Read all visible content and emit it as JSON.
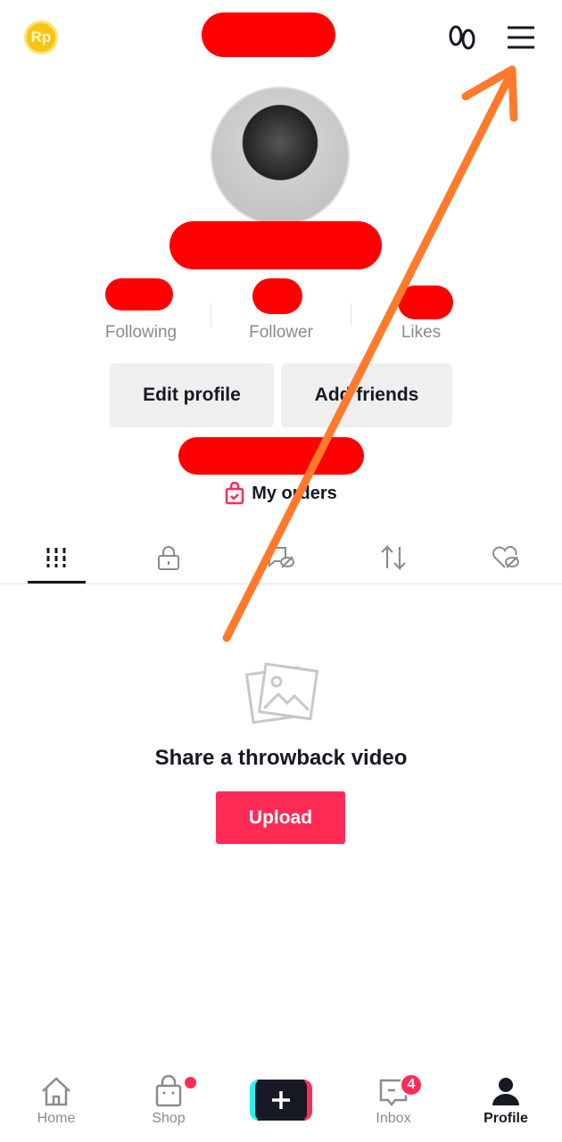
{
  "header": {
    "coin_label": "Rp",
    "footprints_icon": "footprints-icon",
    "menu_icon": "hamburger-menu-icon"
  },
  "profile": {
    "stats": [
      {
        "label": "Following"
      },
      {
        "label": "Follower"
      },
      {
        "label": "Likes"
      }
    ],
    "edit_profile": "Edit profile",
    "add_friends": "Add friends",
    "my_orders": "My orders"
  },
  "tabs": [
    {
      "icon": "grid-videos-icon",
      "active": true
    },
    {
      "icon": "lock-icon"
    },
    {
      "icon": "hidden-tag-icon"
    },
    {
      "icon": "repost-icon"
    },
    {
      "icon": "hidden-likes-icon"
    }
  ],
  "empty": {
    "title": "Share a throwback video",
    "upload": "Upload"
  },
  "bottom_nav": {
    "home": "Home",
    "shop": "Shop",
    "inbox": "Inbox",
    "inbox_badge": "4",
    "profile": "Profile"
  },
  "colors": {
    "accent": "#fe2c55",
    "annotation": "#ff7a2a",
    "redaction": "#ff0000"
  }
}
